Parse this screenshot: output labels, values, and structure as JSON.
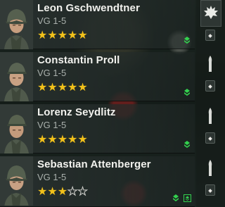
{
  "squad": {
    "members": [
      {
        "name": "Leon Gschwendtner",
        "rank": "VG 1-5",
        "stars": 5,
        "max_stars": 5,
        "perks": [
          "squad-perk-icon"
        ]
      },
      {
        "name": "Constantin Proll",
        "rank": "VG 1-5",
        "stars": 5,
        "max_stars": 5,
        "perks": [
          "squad-perk-icon"
        ]
      },
      {
        "name": "Lorenz Seydlitz",
        "rank": "VG 1-5",
        "stars": 5,
        "max_stars": 5,
        "perks": [
          "squad-perk-icon"
        ]
      },
      {
        "name": "Sebastian Attenberger",
        "rank": "VG 1-5",
        "stars": 3,
        "max_stars": 5,
        "perks": [
          "squad-perk-icon",
          "box-perk-icon"
        ]
      }
    ]
  },
  "slots": {
    "icons": [
      "upgrade-burst-icon",
      "equipment-slot-icon",
      "ammo-round-icon",
      "ammo-round-icon",
      "ammo-round-icon"
    ]
  },
  "colors": {
    "star_on": "#f2c11a",
    "star_off": "#cfcfca",
    "perk_green": "#33d14e",
    "name_text": "#f2f2ee",
    "rank_text": "#a9b0ac"
  }
}
